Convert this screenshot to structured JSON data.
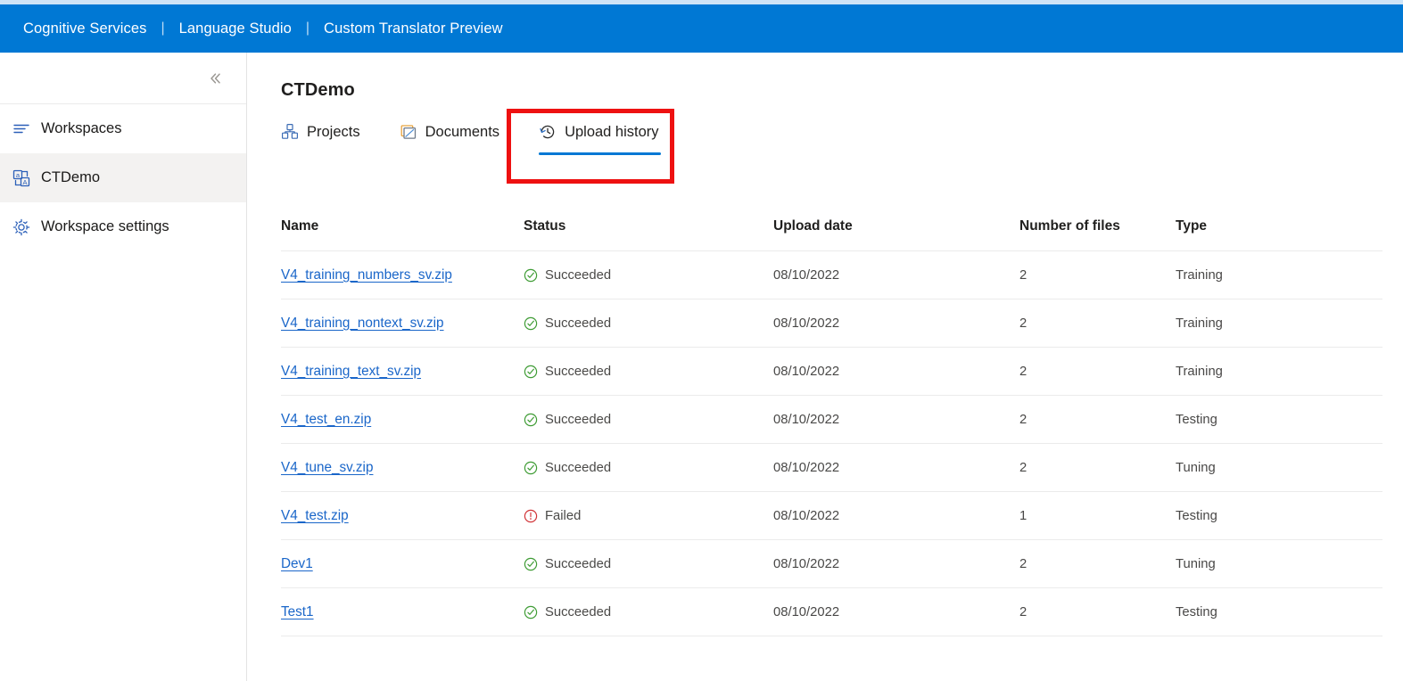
{
  "header": {
    "links": [
      {
        "label": "Cognitive Services",
        "icon": "none"
      },
      {
        "label": "Language Studio",
        "icon": "none"
      },
      {
        "label": "Custom Translator Preview",
        "icon": "none"
      }
    ],
    "separator": "|",
    "background_color": "#0078d4",
    "text_color": "#ffffff"
  },
  "sidebar": {
    "collapse_icon": "chevron-double-left-icon",
    "items": [
      {
        "label": "Workspaces",
        "icon": "workspaces-icon",
        "selected": false
      },
      {
        "label": "CTDemo",
        "icon": "translator-workspace-icon",
        "selected": true
      },
      {
        "label": "Workspace settings",
        "icon": "gear-icon",
        "selected": false
      }
    ]
  },
  "main": {
    "title": "CTDemo",
    "tabs": [
      {
        "label": "Projects",
        "icon": "projects-cubes-icon",
        "active": false
      },
      {
        "label": "Documents",
        "icon": "documents-icon",
        "active": false
      },
      {
        "label": "Upload history",
        "icon": "history-clock-icon",
        "active": true
      }
    ],
    "annotation": {
      "color": "#ee1111",
      "target": "Upload history"
    }
  },
  "table": {
    "columns": [
      "Name",
      "Status",
      "Upload date",
      "Number of files",
      "Type"
    ],
    "rows": [
      {
        "name": "V4_training_numbers_sv.zip",
        "status": "Succeeded",
        "status_icon": "check-circle-icon",
        "date": "08/10/2022",
        "files": "2",
        "type": "Training"
      },
      {
        "name": "V4_training_nontext_sv.zip",
        "status": "Succeeded",
        "status_icon": "check-circle-icon",
        "date": "08/10/2022",
        "files": "2",
        "type": "Training"
      },
      {
        "name": "V4_training_text_sv.zip",
        "status": "Succeeded",
        "status_icon": "check-circle-icon",
        "date": "08/10/2022",
        "files": "2",
        "type": "Training"
      },
      {
        "name": "V4_test_en.zip",
        "status": "Succeeded",
        "status_icon": "check-circle-icon",
        "date": "08/10/2022",
        "files": "2",
        "type": "Testing"
      },
      {
        "name": "V4_tune_sv.zip",
        "status": "Succeeded",
        "status_icon": "check-circle-icon",
        "date": "08/10/2022",
        "files": "2",
        "type": "Tuning"
      },
      {
        "name": "V4_test.zip",
        "status": "Failed",
        "status_icon": "error-circle-icon",
        "date": "08/10/2022",
        "files": "1",
        "type": "Testing"
      },
      {
        "name": "Dev1",
        "status": "Succeeded",
        "status_icon": "check-circle-icon",
        "date": "08/10/2022",
        "files": "2",
        "type": "Tuning"
      },
      {
        "name": "Test1",
        "status": "Succeeded",
        "status_icon": "check-circle-icon",
        "date": "08/10/2022",
        "files": "2",
        "type": "Testing"
      }
    ]
  },
  "colors": {
    "brand_blue": "#0078d4",
    "link_blue": "#1a66c9",
    "success_green": "#3f9c35",
    "error_red": "#d13438",
    "annotation_red": "#ee1111"
  }
}
